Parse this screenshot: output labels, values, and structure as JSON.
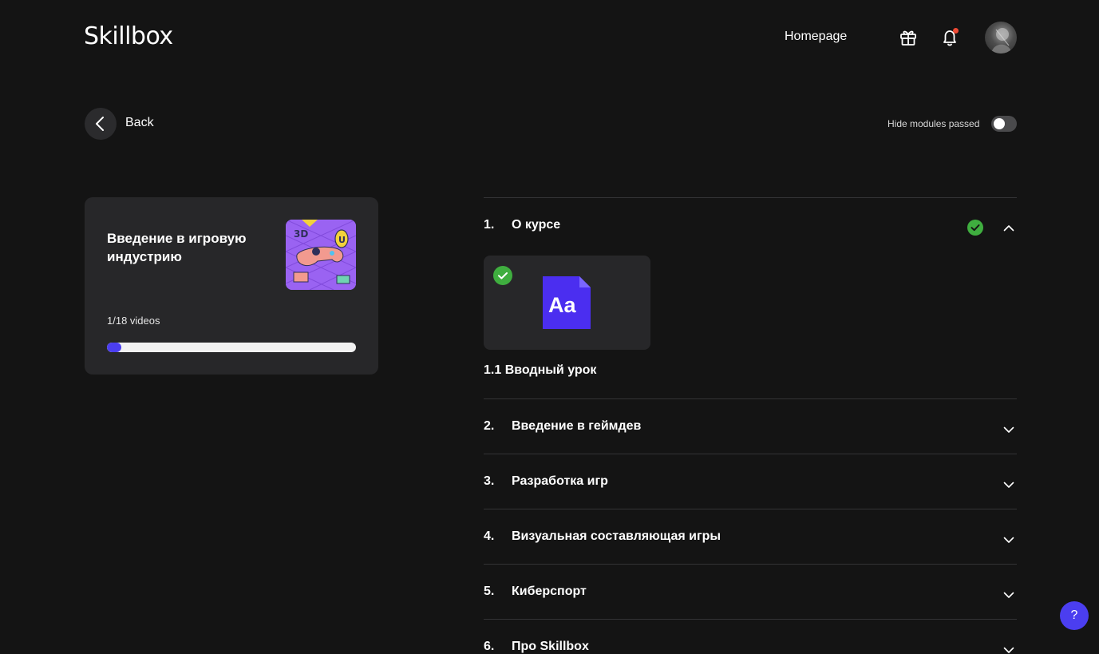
{
  "header": {
    "logo": "Skillbox",
    "homepage_label": "Homepage",
    "icons": [
      "gift-icon",
      "bell-icon"
    ],
    "notification_dot_color": "#ee4a34"
  },
  "nav": {
    "back_label": "Back",
    "hide_modules_label": "Hide modules passed",
    "hide_modules_on": false
  },
  "course": {
    "title": "Введение в игровую индустрию",
    "videos_label": "1/18 videos",
    "progress_fraction": 0.0556,
    "accent_color": "#4b3ef0"
  },
  "modules": [
    {
      "num": "1.",
      "title": "О курсе",
      "completed": true,
      "expanded": true,
      "lessons": [
        {
          "title": "1.1 Вводный урок",
          "icon_text": "Aa",
          "completed": true
        }
      ]
    },
    {
      "num": "2.",
      "title": "Введение в геймдев",
      "completed": false,
      "expanded": false
    },
    {
      "num": "3.",
      "title": "Разработка игр",
      "completed": false,
      "expanded": false
    },
    {
      "num": "4.",
      "title": "Визуальная составляющая игры",
      "completed": false,
      "expanded": false
    },
    {
      "num": "5.",
      "title": "Киберспорт",
      "completed": false,
      "expanded": false
    },
    {
      "num": "6.",
      "title": "Про Skillbox",
      "completed": false,
      "expanded": false
    }
  ],
  "help": {
    "label": "?"
  },
  "colors": {
    "background": "#141414",
    "card": "#272729",
    "success": "#3fae3f"
  }
}
